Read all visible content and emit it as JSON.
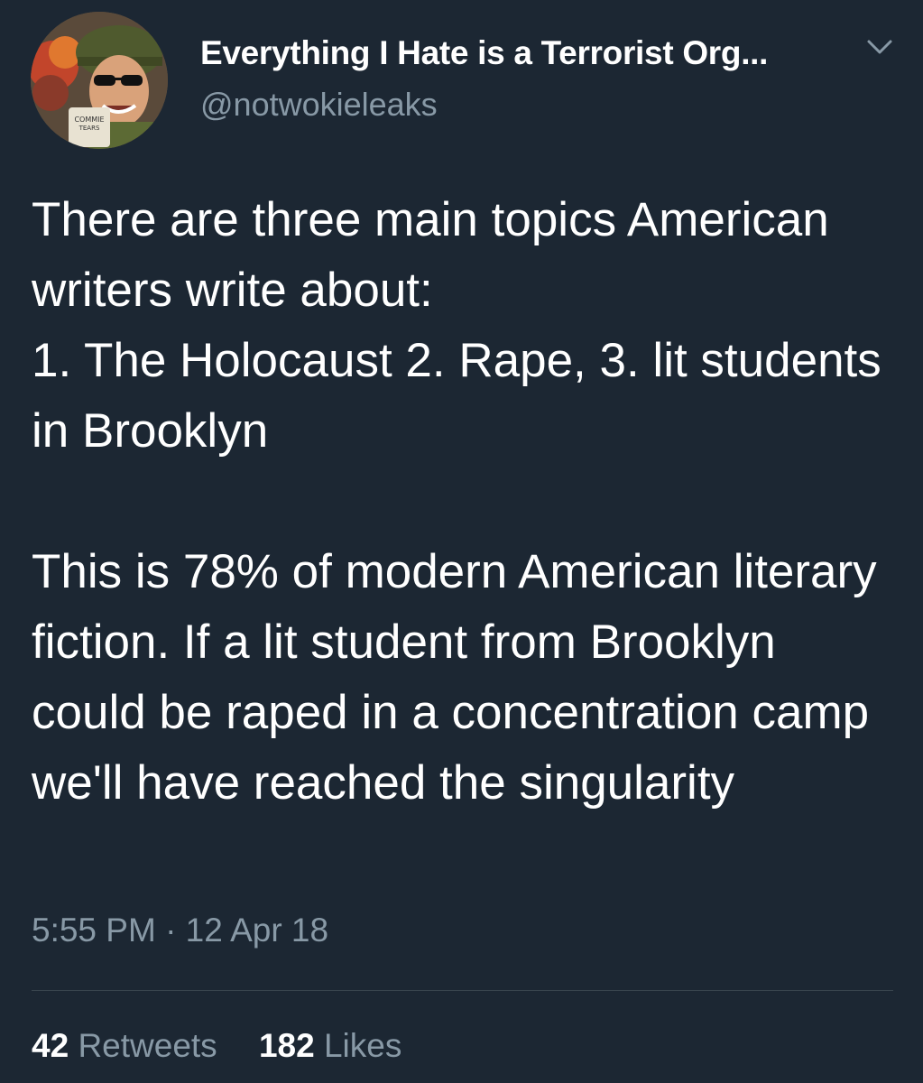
{
  "author": {
    "display_name": "Everything I Hate is a Terrorist Org...",
    "handle": "@notwokieleaks",
    "avatar_mug_text": "COMMIE TEARS"
  },
  "tweet": {
    "lines": [
      "There are three main topics American writers write about:",
      "1. The Holocaust 2. Rape, 3. lit students in Brooklyn",
      "",
      "This is 78% of modern American literary fiction. If a lit student from Brooklyn could be raped in a concentration camp we'll have reached the singularity"
    ],
    "timestamp": "5:55 PM · 12 Apr 18"
  },
  "stats": {
    "retweets_count": "42",
    "retweets_label": "Retweets",
    "likes_count": "182",
    "likes_label": "Likes"
  },
  "icons": {
    "caret": "chevron-down-icon"
  },
  "colors": {
    "background": "#1c2733",
    "text": "#ffffff",
    "secondary_text": "#8899a6",
    "divider": "#38444d"
  }
}
